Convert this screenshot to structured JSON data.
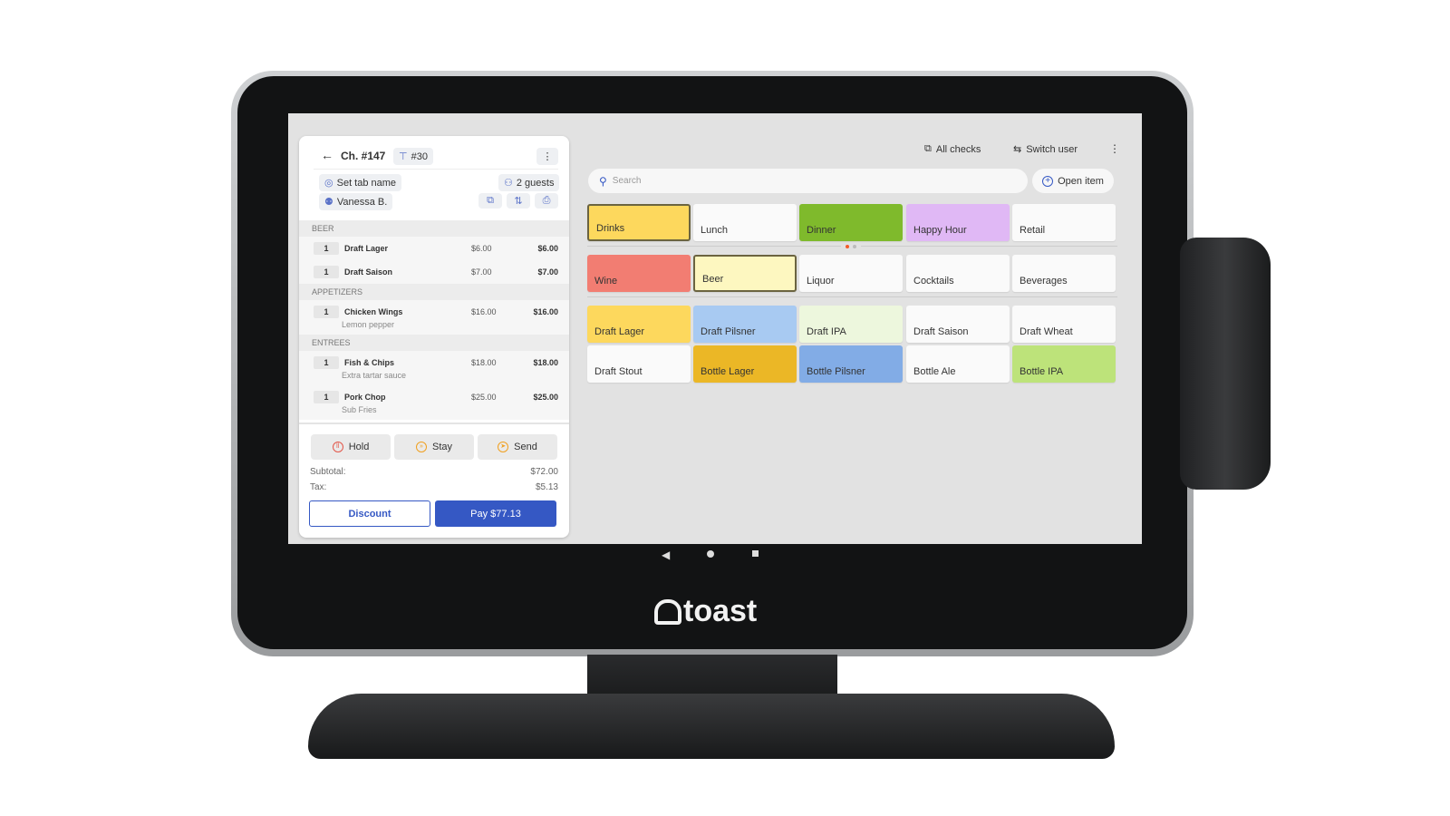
{
  "brand": "toast",
  "check": {
    "title": "Ch. #147",
    "table": "#30",
    "tab_name": "Set tab name",
    "guests": "2 guests",
    "server": "Vanessa B."
  },
  "sections": [
    {
      "name": "BEER",
      "items": [
        {
          "qty": "1",
          "name": "Draft Lager",
          "mod": "",
          "price": "$6.00",
          "total": "$6.00"
        },
        {
          "qty": "1",
          "name": "Draft Saison",
          "mod": "",
          "price": "$7.00",
          "total": "$7.00"
        }
      ]
    },
    {
      "name": "APPETIZERS",
      "items": [
        {
          "qty": "1",
          "name": "Chicken Wings",
          "mod": "Lemon pepper",
          "price": "$16.00",
          "total": "$16.00"
        }
      ]
    },
    {
      "name": "ENTREES",
      "items": [
        {
          "qty": "1",
          "name": "Fish & Chips",
          "mod": "Extra tartar sauce",
          "price": "$18.00",
          "total": "$18.00"
        },
        {
          "qty": "1",
          "name": "Pork Chop",
          "mod": "Sub Fries",
          "price": "$25.00",
          "total": "$25.00"
        }
      ]
    }
  ],
  "actions": {
    "hold": "Hold",
    "stay": "Stay",
    "send": "Send"
  },
  "totals": {
    "subtotal_label": "Subtotal:",
    "subtotal": "$72.00",
    "tax_label": "Tax:",
    "tax": "$5.13"
  },
  "buttons": {
    "discount": "Discount",
    "pay": "Pay $77.13"
  },
  "topbar": {
    "all_checks": "All checks",
    "switch_user": "Switch user"
  },
  "search": {
    "placeholder": "Search",
    "open_item": "Open item"
  },
  "menus": [
    {
      "label": "Drinks",
      "color": "#fdd85d",
      "selected": true
    },
    {
      "label": "Lunch",
      "color": "#fafafa"
    },
    {
      "label": "Dinner",
      "color": "#7fba2c"
    },
    {
      "label": "Happy Hour",
      "color": "#e0b8f5"
    },
    {
      "label": "Retail",
      "color": "#fafafa"
    }
  ],
  "groups": [
    {
      "label": "Wine",
      "color": "#f27d72"
    },
    {
      "label": "Beer",
      "color": "#fdf7c0",
      "selected": true
    },
    {
      "label": "Liquor",
      "color": "#fafafa"
    },
    {
      "label": "Cocktails",
      "color": "#fafafa"
    },
    {
      "label": "Beverages",
      "color": "#fafafa"
    }
  ],
  "items": [
    {
      "label": "Draft Lager",
      "color": "#fdd85d"
    },
    {
      "label": "Draft Pilsner",
      "color": "#a8caf2"
    },
    {
      "label": "Draft IPA",
      "color": "#edf7dd"
    },
    {
      "label": "Draft Saison",
      "color": "#fafafa"
    },
    {
      "label": "Draft Wheat",
      "color": "#fafafa"
    },
    {
      "label": "Draft Stout",
      "color": "#fafafa"
    },
    {
      "label": "Bottle Lager",
      "color": "#ebb726"
    },
    {
      "label": "Bottle Pilsner",
      "color": "#82ace6"
    },
    {
      "label": "Bottle Ale",
      "color": "#fafafa"
    },
    {
      "label": "Bottle IPA",
      "color": "#bde37a"
    }
  ],
  "colors": {
    "accent": "#3558c4",
    "page_dot_active": "#f25c2a"
  }
}
